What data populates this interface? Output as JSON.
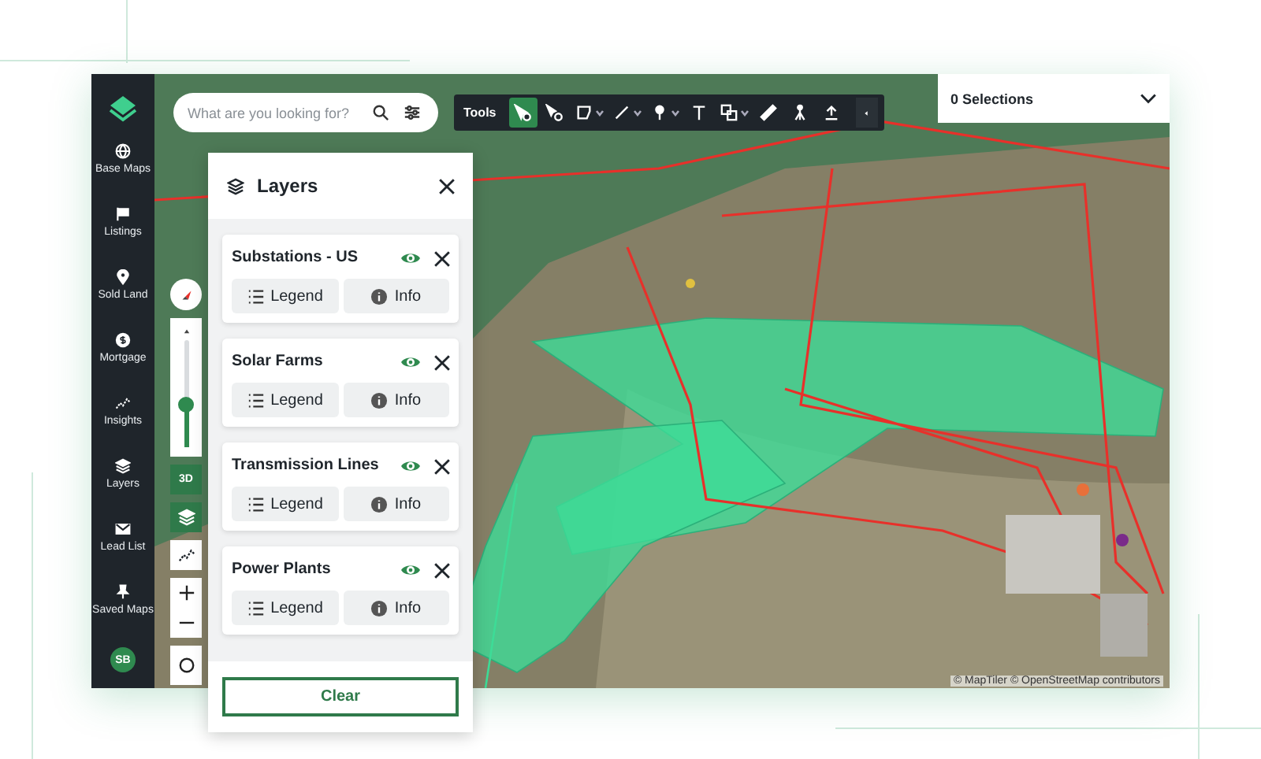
{
  "sidebar": {
    "items": [
      {
        "kind": "globe",
        "label": "Base Maps"
      },
      {
        "kind": "flag",
        "label": "Listings"
      },
      {
        "kind": "pin",
        "label": "Sold Land"
      },
      {
        "kind": "dollar",
        "label": "Mortgage"
      },
      {
        "kind": "chart",
        "label": "Insights"
      },
      {
        "kind": "layers",
        "label": "Layers"
      },
      {
        "kind": "mail",
        "label": "Lead List"
      },
      {
        "kind": "thumbtack",
        "label": "Saved Maps"
      }
    ],
    "avatar": "SB"
  },
  "search": {
    "placeholder": "What are you looking for?"
  },
  "toolbar": {
    "label": "Tools",
    "tools": [
      {
        "kind": "select",
        "selected": true,
        "dropdown": false
      },
      {
        "kind": "point",
        "selected": false,
        "dropdown": false
      },
      {
        "kind": "polygon",
        "selected": false,
        "dropdown": true
      },
      {
        "kind": "line",
        "selected": false,
        "dropdown": true
      },
      {
        "kind": "pin",
        "selected": false,
        "dropdown": true
      },
      {
        "kind": "text",
        "selected": false,
        "dropdown": false
      },
      {
        "kind": "shapes",
        "selected": false,
        "dropdown": true
      },
      {
        "kind": "eraser",
        "selected": false,
        "dropdown": false
      },
      {
        "kind": "survey",
        "selected": false,
        "dropdown": false
      },
      {
        "kind": "upload",
        "selected": false,
        "dropdown": false
      }
    ]
  },
  "selections": {
    "label": "0 Selections"
  },
  "map_controls": {
    "pitch": {
      "level": 0.4
    },
    "buttons": [
      {
        "kind": "threed",
        "label": "3D",
        "selected": true
      },
      {
        "kind": "layers",
        "selected": true
      },
      {
        "kind": "insights",
        "selected": false
      }
    ]
  },
  "layers_panel": {
    "title": "Layers",
    "layers": [
      {
        "name": "Substations - US",
        "visible": true,
        "legend": "Legend",
        "info": "Info"
      },
      {
        "name": "Solar Farms",
        "visible": true,
        "legend": "Legend",
        "info": "Info"
      },
      {
        "name": "Transmission Lines",
        "visible": true,
        "legend": "Legend",
        "info": "Info"
      },
      {
        "name": "Power Plants",
        "visible": true,
        "legend": "Legend",
        "info": "Info"
      }
    ],
    "clear": "Clear"
  },
  "attribution": "© MapTiler © OpenStreetMap contributors"
}
